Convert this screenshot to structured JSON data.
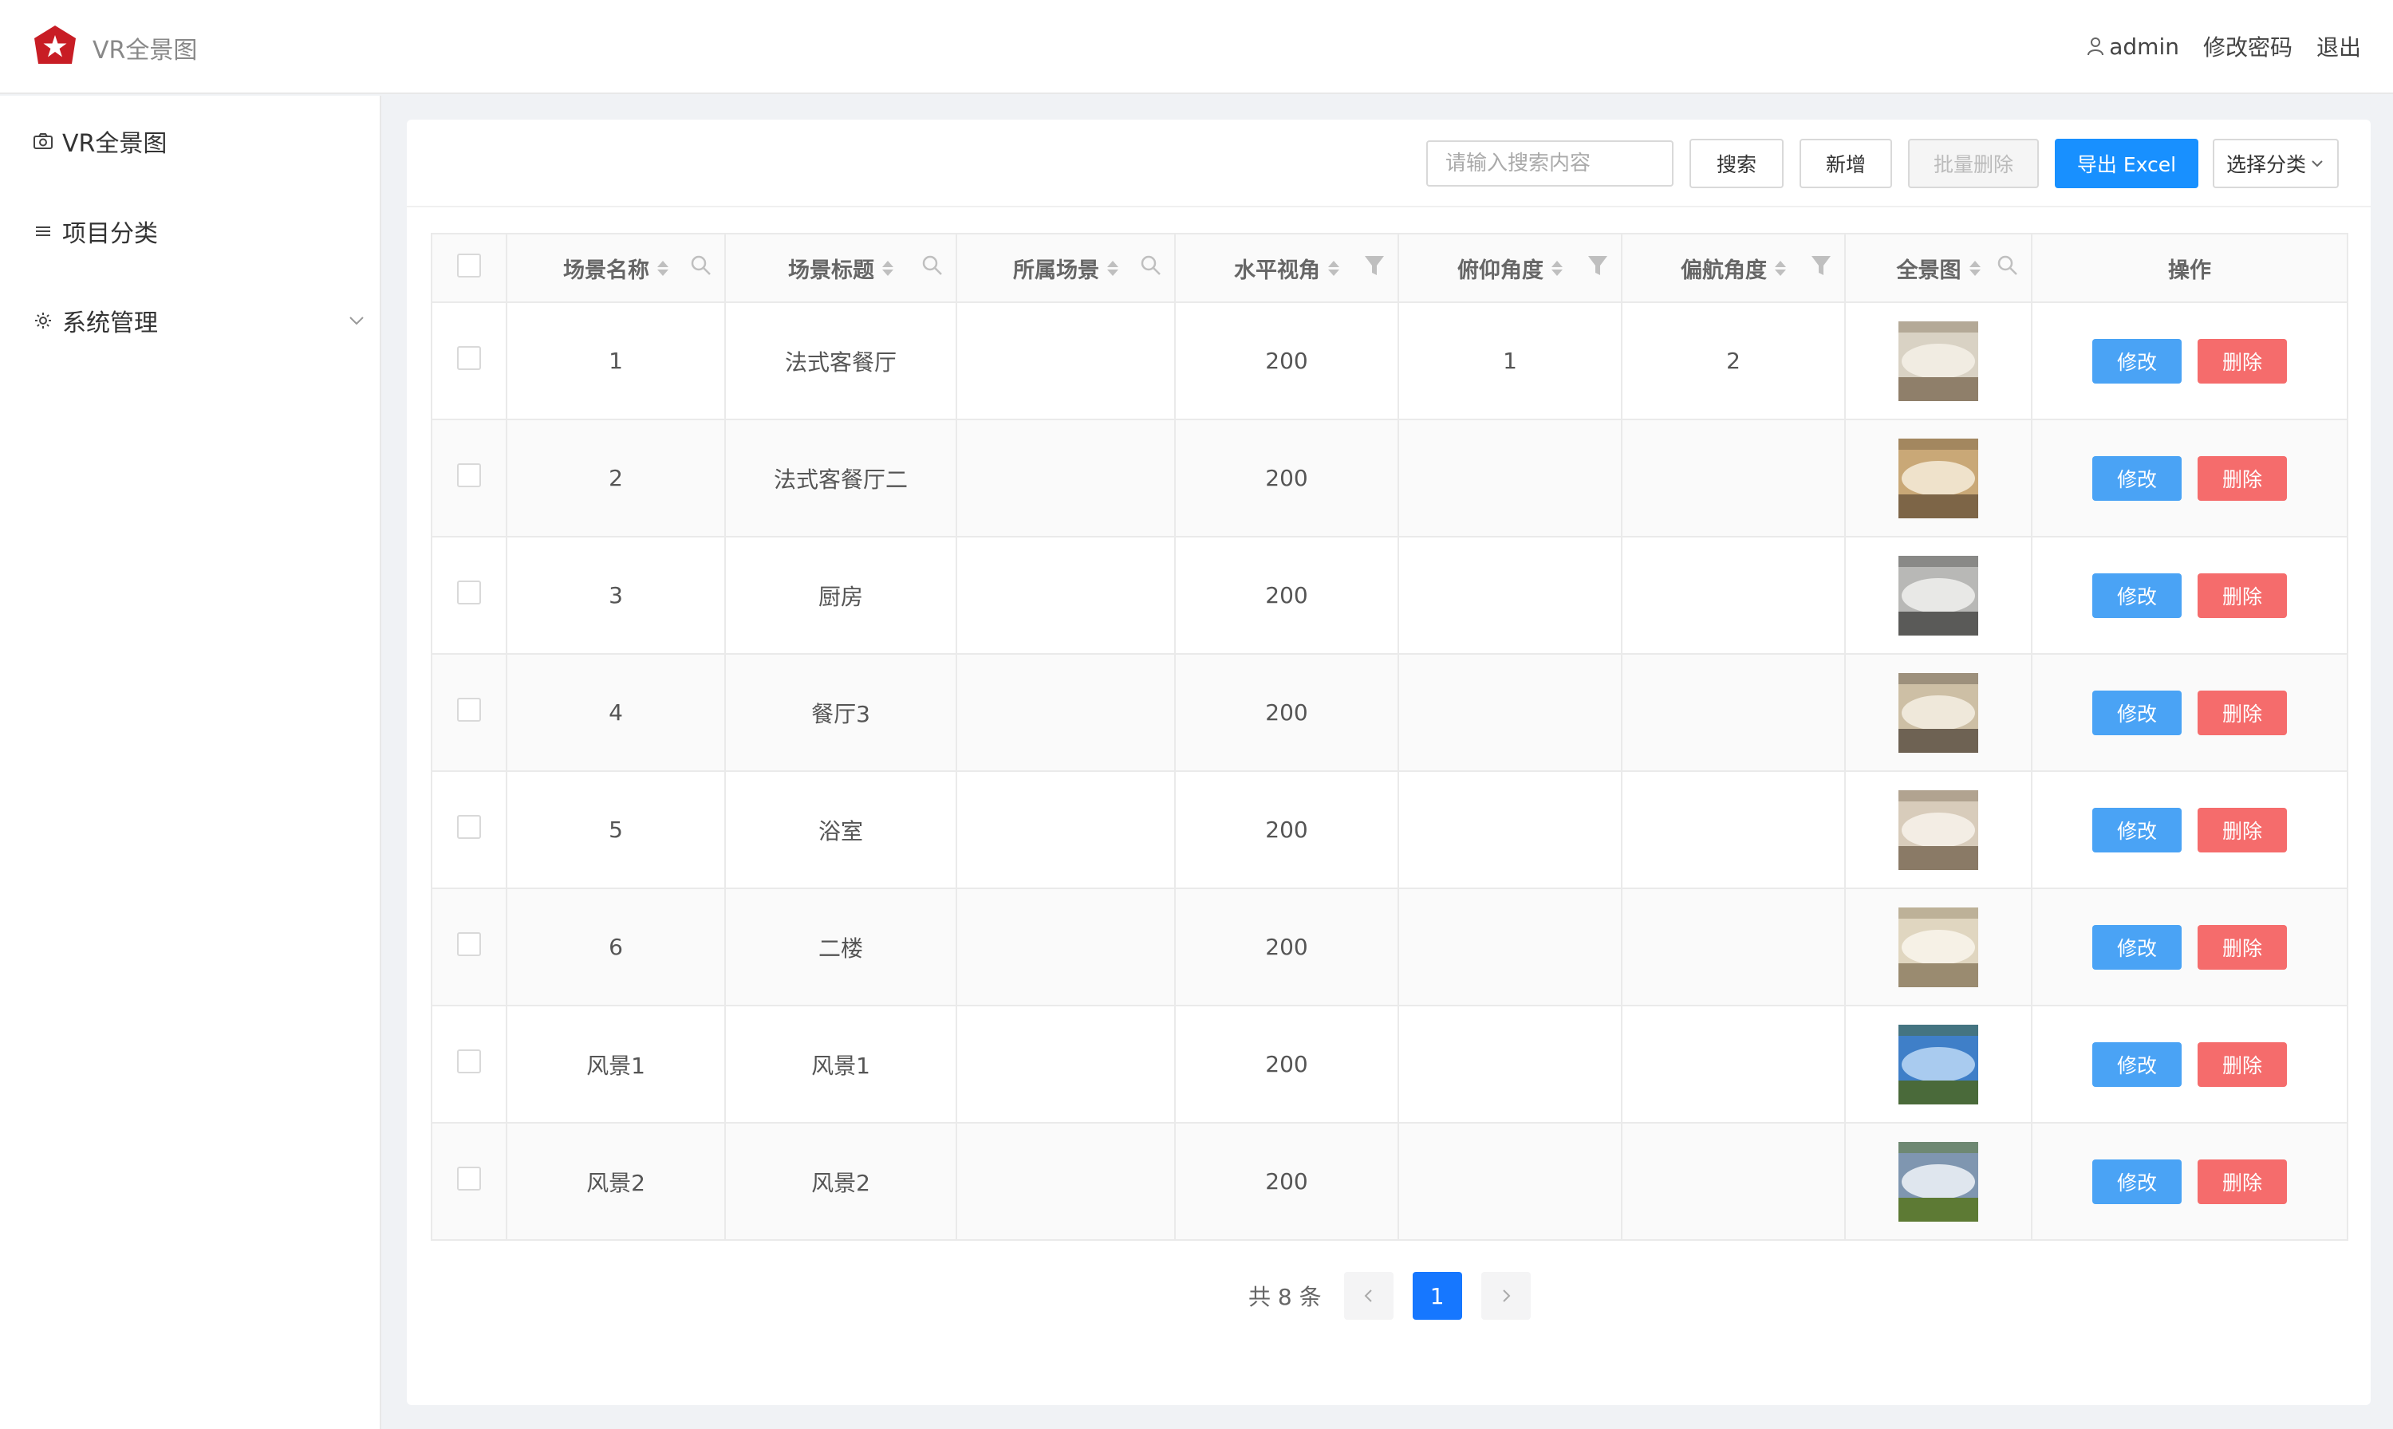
{
  "app": {
    "title": "VR全景图",
    "logo_icon": "star-logo-icon"
  },
  "header": {
    "user_name": "admin",
    "change_password": "修改密码",
    "logout": "退出"
  },
  "sidebar": {
    "items": [
      {
        "label": "VR全景图",
        "icon": "camera-icon"
      },
      {
        "label": "项目分类",
        "icon": "menu-lines-icon"
      },
      {
        "label": "系统管理",
        "icon": "gear-icon",
        "expandable": true
      }
    ]
  },
  "toolbar": {
    "search_placeholder": "请输入搜索内容",
    "search_value": "",
    "search_button": "搜索",
    "add_button": "新增",
    "batch_delete_button": "批量删除",
    "export_button": "导出 Excel",
    "category_select": "选择分类"
  },
  "table": {
    "columns": [
      {
        "label": "场景名称",
        "tool": "search"
      },
      {
        "label": "场景标题",
        "tool": "search"
      },
      {
        "label": "所属场景",
        "tool": "search"
      },
      {
        "label": "水平视角",
        "tool": "filter"
      },
      {
        "label": "俯仰角度",
        "tool": "filter"
      },
      {
        "label": "偏航角度",
        "tool": "filter"
      },
      {
        "label": "全景图",
        "tool": "search"
      },
      {
        "label": "操作",
        "tool": ""
      }
    ],
    "rows": [
      {
        "name": "1",
        "title": "法式客餐厅",
        "scene": "",
        "h_angle": "200",
        "pitch": "1",
        "yaw": "2",
        "thumb": "interior-warm"
      },
      {
        "name": "2",
        "title": "法式客餐厅二",
        "scene": "",
        "h_angle": "200",
        "pitch": "",
        "yaw": "",
        "thumb": "interior-gold"
      },
      {
        "name": "3",
        "title": "厨房",
        "scene": "",
        "h_angle": "200",
        "pitch": "",
        "yaw": "",
        "thumb": "interior-grey"
      },
      {
        "name": "4",
        "title": "餐厅3",
        "scene": "",
        "h_angle": "200",
        "pitch": "",
        "yaw": "",
        "thumb": "interior-beige"
      },
      {
        "name": "5",
        "title": "浴室",
        "scene": "",
        "h_angle": "200",
        "pitch": "",
        "yaw": "",
        "thumb": "interior-bath"
      },
      {
        "name": "6",
        "title": "二楼",
        "scene": "",
        "h_angle": "200",
        "pitch": "",
        "yaw": "",
        "thumb": "interior-light"
      },
      {
        "name": "风景1",
        "title": "风景1",
        "scene": "",
        "h_angle": "200",
        "pitch": "",
        "yaw": "",
        "thumb": "landscape-sky"
      },
      {
        "name": "风景2",
        "title": "风景2",
        "scene": "",
        "h_angle": "200",
        "pitch": "",
        "yaw": "",
        "thumb": "landscape-field"
      }
    ],
    "edit_label": "修改",
    "delete_label": "删除"
  },
  "pagination": {
    "total_text": "共 8 条",
    "current_page": "1"
  },
  "colors": {
    "primary": "#1890ff",
    "danger": "#f56c6c",
    "edit": "#4aa3f5"
  }
}
